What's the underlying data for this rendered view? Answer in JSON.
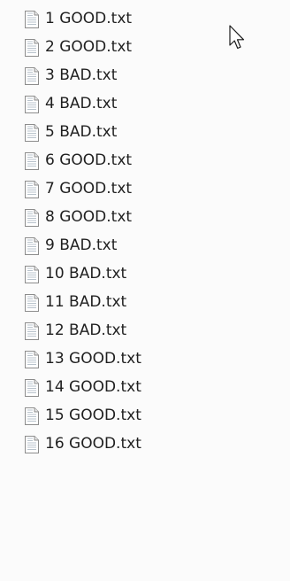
{
  "files": [
    {
      "name": "1 GOOD.txt",
      "icon": "text-file-icon"
    },
    {
      "name": "2 GOOD.txt",
      "icon": "text-file-icon"
    },
    {
      "name": "3 BAD.txt",
      "icon": "text-file-icon"
    },
    {
      "name": "4 BAD.txt",
      "icon": "text-file-icon"
    },
    {
      "name": "5 BAD.txt",
      "icon": "text-file-icon"
    },
    {
      "name": "6 GOOD.txt",
      "icon": "text-file-icon"
    },
    {
      "name": "7 GOOD.txt",
      "icon": "text-file-icon"
    },
    {
      "name": "8 GOOD.txt",
      "icon": "text-file-icon"
    },
    {
      "name": "9 BAD.txt",
      "icon": "text-file-icon"
    },
    {
      "name": "10 BAD.txt",
      "icon": "text-file-icon"
    },
    {
      "name": "11 BAD.txt",
      "icon": "text-file-icon"
    },
    {
      "name": "12 BAD.txt",
      "icon": "text-file-icon"
    },
    {
      "name": "13 GOOD.txt",
      "icon": "text-file-icon"
    },
    {
      "name": "14 GOOD.txt",
      "icon": "text-file-icon"
    },
    {
      "name": "15 GOOD.txt",
      "icon": "text-file-icon"
    },
    {
      "name": "16 GOOD.txt",
      "icon": "text-file-icon"
    }
  ],
  "colors": {
    "background": "#fbfbfb",
    "text": "#1f1f1f",
    "icon_page": "#ffffff",
    "icon_border": "#8c8c8c",
    "icon_lines": "#b9c3cc"
  },
  "cursor": "arrow-cursor-icon"
}
